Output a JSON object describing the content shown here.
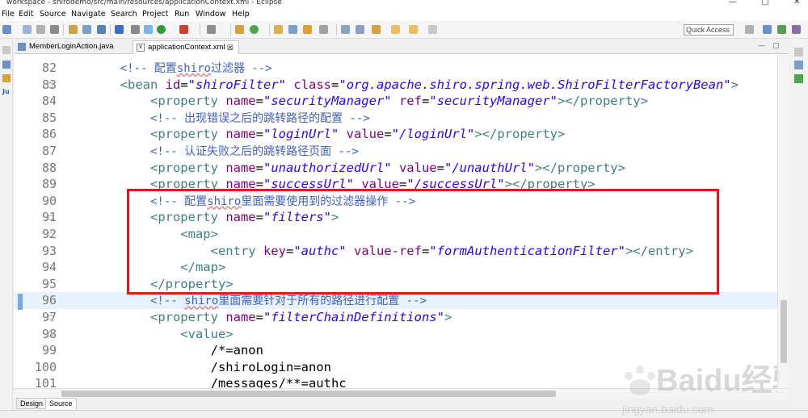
{
  "window": {
    "title": "workspace - shirodemo/src/main/resources/applicationContext.xml - Eclipse"
  },
  "menu": [
    "File",
    "Edit",
    "Source",
    "Navigate",
    "Search",
    "Project",
    "Run",
    "Window",
    "Help"
  ],
  "toolbar": {
    "quick_access": "Quick Access"
  },
  "tabs": [
    {
      "label": "MemberLoginAction.java",
      "active": false
    },
    {
      "label": "applicationContext.xml",
      "active": true,
      "close": "☒"
    }
  ],
  "editor": {
    "current_line": 96,
    "lines": [
      {
        "n": "82",
        "indent": "        ",
        "tokens": [
          [
            "cmt",
            "<!-- 配置"
          ],
          [
            "cmtb",
            "shiro"
          ],
          [
            "cmt",
            "过滤器 -->"
          ]
        ]
      },
      {
        "n": "83",
        "indent": "        ",
        "fold": true,
        "tokens": [
          [
            "tag",
            "<bean "
          ],
          [
            "attr",
            "id"
          ],
          [
            "txt",
            "="
          ],
          [
            "val",
            "\"shiroFilter\""
          ],
          [
            "txt",
            " "
          ],
          [
            "attr",
            "class"
          ],
          [
            "txt",
            "="
          ],
          [
            "val",
            "\"org.apache.shiro.spring.web.ShiroFilterFactoryBean\""
          ],
          [
            "tag",
            ">"
          ]
        ]
      },
      {
        "n": "84",
        "indent": "            ",
        "tokens": [
          [
            "tag",
            "<property "
          ],
          [
            "attr",
            "name"
          ],
          [
            "txt",
            "="
          ],
          [
            "val",
            "\"securityManager\""
          ],
          [
            "txt",
            " "
          ],
          [
            "attr",
            "ref"
          ],
          [
            "txt",
            "="
          ],
          [
            "val",
            "\"securityManager\""
          ],
          [
            "tag",
            "></property>"
          ]
        ]
      },
      {
        "n": "85",
        "indent": "            ",
        "tokens": [
          [
            "cmt",
            "<!-- 出现错误之后的跳转路径的配置 -->"
          ]
        ]
      },
      {
        "n": "86",
        "indent": "            ",
        "tokens": [
          [
            "tag",
            "<property "
          ],
          [
            "attr",
            "name"
          ],
          [
            "txt",
            "="
          ],
          [
            "val",
            "\"loginUrl\""
          ],
          [
            "txt",
            " "
          ],
          [
            "attr",
            "value"
          ],
          [
            "txt",
            "="
          ],
          [
            "val",
            "\"/loginUrl\""
          ],
          [
            "tag",
            "></property>"
          ]
        ]
      },
      {
        "n": "87",
        "indent": "            ",
        "tokens": [
          [
            "cmt",
            "<!-- 认证失败之后的跳转路径页面 -->"
          ]
        ]
      },
      {
        "n": "88",
        "indent": "            ",
        "tokens": [
          [
            "tag",
            "<property "
          ],
          [
            "attr",
            "name"
          ],
          [
            "txt",
            "="
          ],
          [
            "val",
            "\"unauthorizedUrl\""
          ],
          [
            "txt",
            " "
          ],
          [
            "attr",
            "value"
          ],
          [
            "txt",
            "="
          ],
          [
            "val",
            "\"/unauthUrl\""
          ],
          [
            "tag",
            "></property>"
          ]
        ]
      },
      {
        "n": "89",
        "indent": "            ",
        "tokens": [
          [
            "tag",
            "<property "
          ],
          [
            "attr",
            "name"
          ],
          [
            "txt",
            "="
          ],
          [
            "val",
            "\"successUrl\""
          ],
          [
            "txt",
            " "
          ],
          [
            "attr",
            "value"
          ],
          [
            "txt",
            "="
          ],
          [
            "val",
            "\"/successUrl\""
          ],
          [
            "tag",
            "></property>"
          ]
        ]
      },
      {
        "n": "90",
        "indent": "            ",
        "tokens": [
          [
            "cmt",
            "<!-- 配置"
          ],
          [
            "cmtb",
            "shiro"
          ],
          [
            "cmt",
            "里面需要使用到的过滤器操作 -->"
          ]
        ]
      },
      {
        "n": "91",
        "indent": "            ",
        "fold": true,
        "tokens": [
          [
            "tag",
            "<property "
          ],
          [
            "attr",
            "name"
          ],
          [
            "txt",
            "="
          ],
          [
            "val",
            "\"filters\""
          ],
          [
            "tag",
            ">"
          ]
        ]
      },
      {
        "n": "92",
        "indent": "                ",
        "fold": true,
        "tokens": [
          [
            "tag",
            "<map>"
          ]
        ]
      },
      {
        "n": "93",
        "indent": "                    ",
        "tokens": [
          [
            "tag",
            "<entry "
          ],
          [
            "attr",
            "key"
          ],
          [
            "txt",
            "="
          ],
          [
            "val",
            "\"authc\""
          ],
          [
            "txt",
            " "
          ],
          [
            "attr",
            "value-ref"
          ],
          [
            "txt",
            "="
          ],
          [
            "val",
            "\"formAuthenticationFilter\""
          ],
          [
            "tag",
            "></entry>"
          ]
        ]
      },
      {
        "n": "94",
        "indent": "                ",
        "tokens": [
          [
            "tag",
            "</map>"
          ]
        ]
      },
      {
        "n": "95",
        "indent": "            ",
        "tokens": [
          [
            "tag",
            "</property>"
          ]
        ]
      },
      {
        "n": "96",
        "indent": "            ",
        "tokens": [
          [
            "cmt",
            "<!-- "
          ],
          [
            "cmtb",
            "shiro"
          ],
          [
            "cmt",
            "里面需要针对于所有的路径进行配置 -->"
          ]
        ]
      },
      {
        "n": "97",
        "indent": "            ",
        "fold": true,
        "tokens": [
          [
            "tag",
            "<property "
          ],
          [
            "attr",
            "name"
          ],
          [
            "txt",
            "="
          ],
          [
            "val",
            "\"filterChainDefinitions\""
          ],
          [
            "tag",
            ">"
          ]
        ]
      },
      {
        "n": "98",
        "indent": "                ",
        "fold": true,
        "tokens": [
          [
            "tag",
            "<value>"
          ]
        ]
      },
      {
        "n": "99",
        "indent": "                    ",
        "tokens": [
          [
            "txt",
            "/*=anon"
          ]
        ]
      },
      {
        "n": "100",
        "indent": "                    ",
        "tokens": [
          [
            "txt",
            "/shiroLogin=anon"
          ]
        ]
      },
      {
        "n": "101",
        "indent": "                    ",
        "tokens": [
          [
            "txt",
            "/messages/**=authc"
          ]
        ]
      }
    ]
  },
  "bottom_tabs": [
    "Design",
    "Source"
  ],
  "watermark": {
    "brand": "Baidu经验",
    "url": "jingyan.baidu.com"
  },
  "colors": {
    "annotation_box": "#e8141b",
    "current_line": "#e8f2fe"
  }
}
